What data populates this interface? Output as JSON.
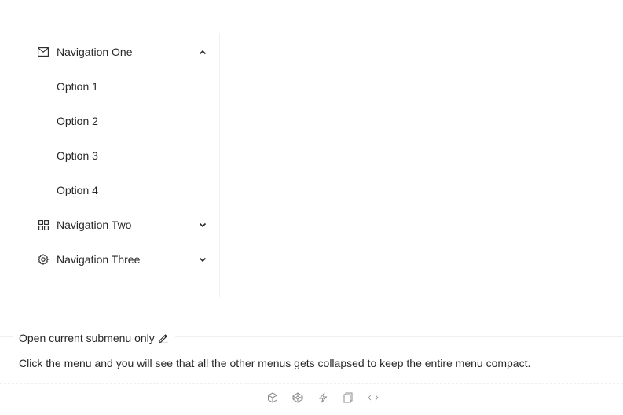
{
  "menu": {
    "nav_one": {
      "label": "Navigation One",
      "icon": "mail-icon",
      "expanded": true,
      "options": [
        "Option 1",
        "Option 2",
        "Option 3",
        "Option 4"
      ]
    },
    "nav_two": {
      "label": "Navigation Two",
      "icon": "appstore-icon",
      "expanded": false
    },
    "nav_three": {
      "label": "Navigation Three",
      "icon": "setting-icon",
      "expanded": false
    }
  },
  "section": {
    "title": "Open current submenu only",
    "description": "Click the menu and you will see that all the other menus gets collapsed to keep the entire menu compact."
  },
  "actions": [
    "codesandbox-icon",
    "codepen-icon",
    "thunderbolt-icon",
    "copy-icon",
    "code-icon"
  ],
  "colors": {
    "text": "#262626",
    "divider": "#f0f0f0",
    "icon_muted": "#8c8c8c"
  }
}
